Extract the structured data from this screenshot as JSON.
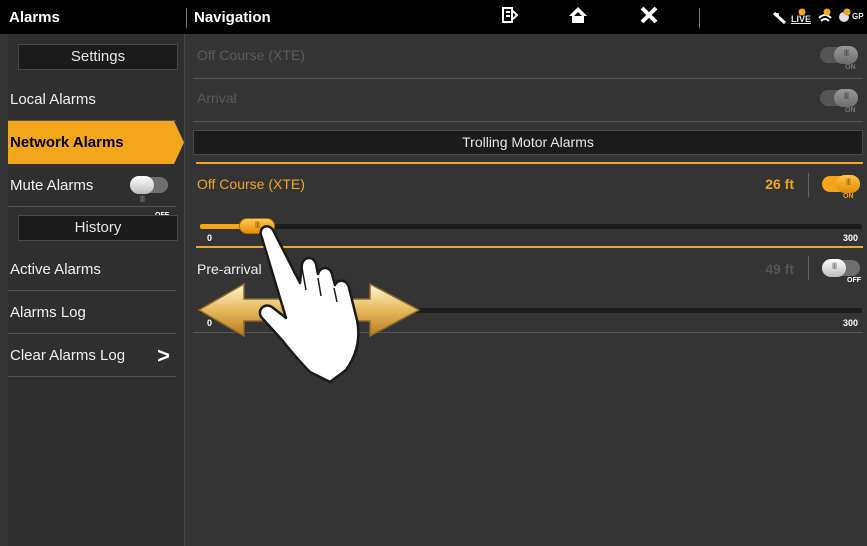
{
  "topbar": {
    "left_title": "Alarms",
    "nav_title": "Navigation",
    "status": {
      "live": "LIVE",
      "gps": "GP"
    }
  },
  "sidebar": {
    "settings_header": "Settings",
    "items_top": [
      {
        "label": "Local Alarms"
      },
      {
        "label": "Network Alarms",
        "active": true
      },
      {
        "label": "Mute Alarms",
        "toggle_state": "OFF"
      }
    ],
    "history_header": "History",
    "items_bottom": [
      {
        "label": "Active Alarms"
      },
      {
        "label": "Alarms Log"
      },
      {
        "label": "Clear Alarms Log",
        "chevron": ">"
      }
    ]
  },
  "main": {
    "rows": [
      {
        "label": "Off Course (XTE)",
        "toggle_state": "ON"
      },
      {
        "label": "Arrival",
        "toggle_state": "ON"
      }
    ],
    "section_title": "Trolling Motor Alarms",
    "tm_rows": [
      {
        "label": "Off Course (XTE)",
        "value": "26 ft",
        "toggle_state": "ON",
        "slider_min": "0",
        "slider_max": "300",
        "slider_value": 26
      },
      {
        "label": "Pre-arrival",
        "value": "49 ft",
        "toggle_state": "OFF",
        "slider_min": "0",
        "slider_max": "300",
        "slider_value": 0
      }
    ]
  },
  "colors": {
    "accent": "#f3a51b",
    "background": "#343434",
    "topbar": "#000000"
  },
  "icons": [
    "waypoint-list-icon",
    "home-icon",
    "close-icon",
    "sonar-icon",
    "live-icon",
    "radar-icon",
    "gps-icon",
    "tap-hand-icon",
    "drag-arrows-icon"
  ]
}
